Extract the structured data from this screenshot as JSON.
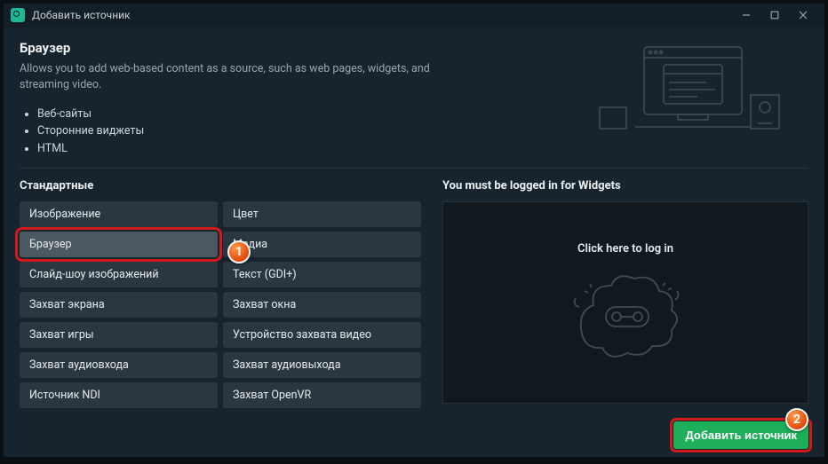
{
  "window": {
    "title": "Добавить источник"
  },
  "hero": {
    "title": "Браузер",
    "description": "Allows you to add web-based content as a source, such as web pages, widgets, and streaming video.",
    "bullets": [
      "Веб-сайты",
      "Сторонние виджеты",
      "HTML"
    ]
  },
  "standard": {
    "title": "Стандартные",
    "rows": [
      [
        "Изображение",
        "Цвет"
      ],
      [
        "Браузер",
        "Медиа"
      ],
      [
        "Слайд-шоу изображений",
        "Текст (GDI+)"
      ],
      [
        "Захват экрана",
        "Захват окна"
      ],
      [
        "Захват игры",
        "Устройство захвата видео"
      ],
      [
        "Захват аудиовхода",
        "Захват аудиовыхода"
      ],
      [
        "Источник NDI",
        "Захват OpenVR"
      ]
    ],
    "selected_row": 1,
    "selected_col": 0
  },
  "widgets": {
    "title": "You must be logged in for Widgets",
    "login_text": "Click here to log in"
  },
  "footer": {
    "add_label": "Добавить источник"
  },
  "annotations": {
    "badge1": "1",
    "badge2": "2"
  }
}
